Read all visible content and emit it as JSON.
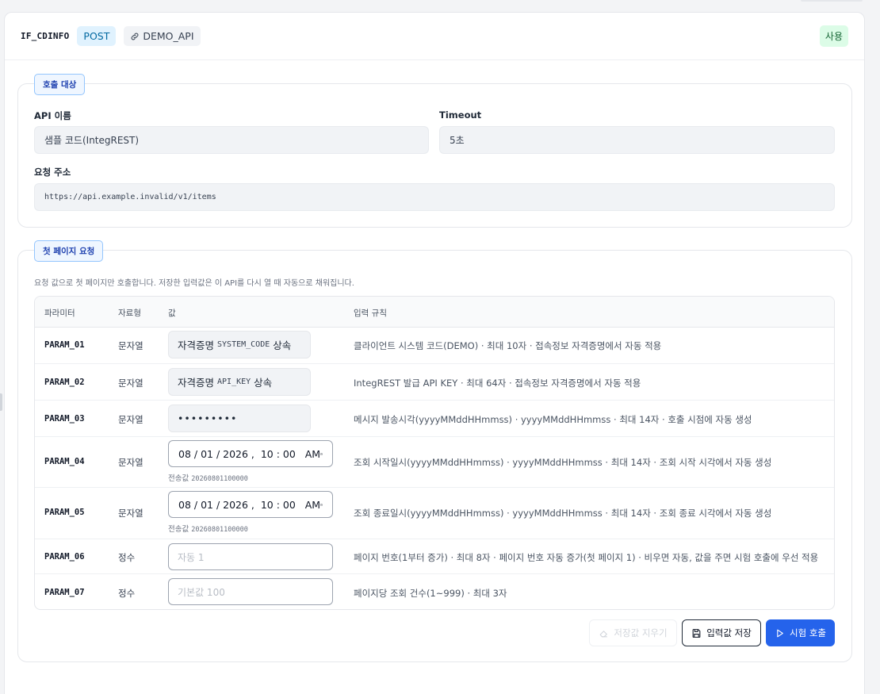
{
  "header": {
    "interface_code": "IF_CDINFO",
    "method": "POST",
    "api_code": "DEMO_API",
    "status": "사용"
  },
  "target": {
    "tag": "호출 대상",
    "api_name_label": "API 이름",
    "api_name_value": "샘플 코드(IntegREST)",
    "timeout_label": "Timeout",
    "timeout_value": "5초",
    "url_label": "요청 주소",
    "url_value": "https://api.example.invalid/v1/items"
  },
  "first_page": {
    "tag": "첫 페이지 요청",
    "hint": "요청 값으로 첫 페이지만 호출합니다. 저장한 입력값은 이 API를 다시 열 때 자동으로 채워집니다.",
    "columns": [
      "파라미터",
      "자료형",
      "값",
      "입력 규칙"
    ],
    "rows": [
      {
        "param": "PARAM_01",
        "type": "문자열",
        "value_prefix": "자격증명",
        "value_code": "SYSTEM_CODE",
        "value_suffix": "상속",
        "rule": "클라이언트 시스템 코드(DEMO) · 최대 10자 · 접속정보 자격증명에서 자동 적용"
      },
      {
        "param": "PARAM_02",
        "type": "문자열",
        "value_prefix": "자격증명",
        "value_code": "API_KEY",
        "value_suffix": "상속",
        "rule": "IntegREST 발급 API KEY · 최대 64자 · 접속정보 자격증명에서 자동 적용"
      },
      {
        "param": "PARAM_03",
        "type": "문자열",
        "value_masked": "•••••••••",
        "rule": "메시지 발송시각(yyyyMMddHHmmss) · yyyyMMddHHmmss · 최대 14자 · 호출 시점에 자동 생성"
      },
      {
        "param": "PARAM_04",
        "type": "문자열",
        "value_datetime": "08 / 01 / 2026 ,  10 : 00   AM",
        "sent_label": "전송값",
        "sent_value": "20260801100000",
        "rule": "조회 시작일시(yyyyMMddHHmmss) · yyyyMMddHHmmss · 최대 14자 · 조회 시작 시각에서 자동 생성"
      },
      {
        "param": "PARAM_05",
        "type": "문자열",
        "value_datetime": "08 / 01 / 2026 ,  10 : 00   AM",
        "sent_label": "전송값",
        "sent_value": "20260801100000",
        "rule": "조회 종료일시(yyyyMMddHHmmss) · yyyyMMddHHmmss · 최대 14자 · 조회 종료 시각에서 자동 생성"
      },
      {
        "param": "PARAM_06",
        "type": "정수",
        "placeholder": "자동 1",
        "rule": "페이지 번호(1부터 증가) · 최대 8자 · 페이지 번호 자동 증가(첫 페이지 1) · 비우면 자동, 값을 주면 시험 호출에 우선 적용"
      },
      {
        "param": "PARAM_07",
        "type": "정수",
        "placeholder": "기본값 100",
        "rule": "페이지당 조회 건수(1~999) · 최대 3자"
      }
    ],
    "buttons": {
      "clear": "저장값 지우기",
      "save": "입력값 저장",
      "call": "시험 호출"
    }
  },
  "icons": {
    "link": "link-icon",
    "clear": "eraser-icon",
    "save": "floppy-disk-icon",
    "call": "play-icon",
    "calendar": "calendar-icon"
  },
  "colors": {
    "accent": "#2563eb",
    "method_bg": "#e0f2fe",
    "status_bg": "#dcfce7"
  }
}
